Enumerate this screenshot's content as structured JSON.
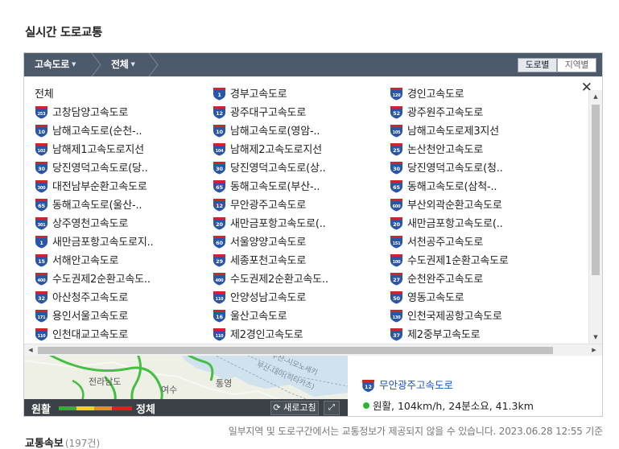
{
  "page_title": "실시간 도로교통",
  "breadcrumb": {
    "level1": "고속도로",
    "level2": "전체"
  },
  "view_toggle": {
    "road": "도로별",
    "region": "지역별"
  },
  "dropdown": {
    "close_icon": "close-icon",
    "items": [
      {
        "label": "전체",
        "num": ""
      },
      {
        "label": "경부고속도로",
        "num": "1"
      },
      {
        "label": "경인고속도로",
        "num": "120"
      },
      {
        "label": "고창담양고속도로",
        "num": "253"
      },
      {
        "label": "광주대구고속도로",
        "num": "12"
      },
      {
        "label": "광주원주고속도로",
        "num": "52"
      },
      {
        "label": "남해고속도로(순천-..",
        "num": "10"
      },
      {
        "label": "남해고속도로(영암-..",
        "num": "10"
      },
      {
        "label": "남해고속도로제3지선",
        "num": "105"
      },
      {
        "label": "남해제1고속도로지선",
        "num": "102"
      },
      {
        "label": "남해제2고속도로지선",
        "num": "104"
      },
      {
        "label": "논산천안고속도로",
        "num": "25"
      },
      {
        "label": "당진영덕고속도로(당..",
        "num": "30"
      },
      {
        "label": "당진영덕고속도로(상..",
        "num": "30"
      },
      {
        "label": "당진영덕고속도로(청..",
        "num": "30"
      },
      {
        "label": "대전남부순환고속도로",
        "num": "300"
      },
      {
        "label": "동해고속도로(부산-..",
        "num": "65"
      },
      {
        "label": "동해고속도로(삼척-..",
        "num": "65"
      },
      {
        "label": "동해고속도로(울산-..",
        "num": "65"
      },
      {
        "label": "무안광주고속도로",
        "num": "12"
      },
      {
        "label": "부산외곽순환고속도로",
        "num": "600"
      },
      {
        "label": "상주영천고속도로",
        "num": "301"
      },
      {
        "label": "새만금포항고속도로(..",
        "num": "20"
      },
      {
        "label": "새만금포항고속도로(..",
        "num": "20"
      },
      {
        "label": "새만금포항고속도로지..",
        "num": "1"
      },
      {
        "label": "서울양양고속도로",
        "num": "60"
      },
      {
        "label": "서천공주고속도로",
        "num": "151"
      },
      {
        "label": "서해안고속도로",
        "num": "15"
      },
      {
        "label": "세종포천고속도로",
        "num": "29"
      },
      {
        "label": "수도권제1순환고속도로",
        "num": "100"
      },
      {
        "label": "수도권제2순환고속도..",
        "num": "400"
      },
      {
        "label": "수도권제2순환고속도..",
        "num": "400"
      },
      {
        "label": "순천완주고속도로",
        "num": "27"
      },
      {
        "label": "아산청주고속도로",
        "num": "32"
      },
      {
        "label": "안양성남고속도로",
        "num": "110"
      },
      {
        "label": "영동고속도로",
        "num": "50"
      },
      {
        "label": "용인서울고속도로",
        "num": "171"
      },
      {
        "label": "울산고속도로",
        "num": "16"
      },
      {
        "label": "인천국제공항고속도로",
        "num": "130"
      },
      {
        "label": "인천대교고속도로",
        "num": "110"
      },
      {
        "label": "제2경인고속도로",
        "num": "110"
      },
      {
        "label": "제2중부고속도로",
        "num": "37"
      }
    ]
  },
  "map": {
    "labels": [
      "전라남도",
      "여수",
      "통영",
      "부산-시모노세키",
      "부산-대마(히타카츠)"
    ],
    "legend_good": "원활",
    "legend_bad": "정체",
    "legend_colors": [
      "#2fb12f",
      "#f3d21a",
      "#f08a1a",
      "#e01e1e"
    ],
    "refresh_label": "새로고침",
    "refresh_icon": "refresh-icon",
    "fullscreen_icon": "fullscreen-icon"
  },
  "detail": {
    "route_num": "12",
    "route_name": "무안광주고속도로",
    "status_text": "원활, 104km/h, 24분소요, 41.3km",
    "status_color": "#2bb52f"
  },
  "footnote": "일부지역 및 도로구간에서는 교통정보가 제공되지 않을 수 있습니다. 2023.06.28 12:55 기준",
  "section": {
    "title": "교통속보",
    "count": "(197건)"
  }
}
